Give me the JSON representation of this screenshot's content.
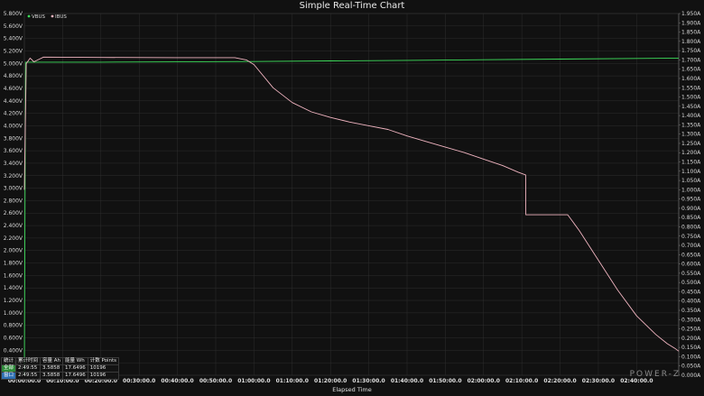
{
  "chart_data": {
    "type": "line",
    "title": "Simple Real-Time Chart",
    "xlabel": "Elapsed Time",
    "x_unit": "minutes",
    "xlim": [
      0,
      171
    ],
    "x_ticks": [
      "00:00:00.0",
      "00:10:00.0",
      "00:20:00.0",
      "00:30:00.0",
      "00:40:00.0",
      "00:50:00.0",
      "01:00:00.0",
      "01:10:00.0",
      "01:20:00.0",
      "01:30:00.0",
      "01:40:00.0",
      "01:50:00.0",
      "02:00:00.0",
      "02:10:00.0",
      "02:20:00.0",
      "02:30:00.0",
      "02:40:00.0"
    ],
    "y_left": {
      "ylim": [
        0,
        5.8
      ],
      "ticks": [
        "0.200V",
        "0.400V",
        "0.600V",
        "0.800V",
        "1.000V",
        "1.200V",
        "1.400V",
        "1.600V",
        "1.800V",
        "2.000V",
        "2.200V",
        "2.400V",
        "2.600V",
        "2.800V",
        "3.000V",
        "3.200V",
        "3.400V",
        "3.600V",
        "3.800V",
        "4.000V",
        "4.200V",
        "4.400V",
        "4.600V",
        "4.800V",
        "5.000V",
        "5.200V",
        "5.400V",
        "5.600V",
        "5.800V"
      ]
    },
    "y_right": {
      "ylim": [
        0,
        1.95
      ],
      "ticks": [
        "0.000A",
        "0.050A",
        "0.100A",
        "0.150A",
        "0.200A",
        "0.250A",
        "0.300A",
        "0.350A",
        "0.400A",
        "0.450A",
        "0.500A",
        "0.550A",
        "0.600A",
        "0.650A",
        "0.700A",
        "0.750A",
        "0.800A",
        "0.850A",
        "0.900A",
        "0.950A",
        "1.000A",
        "1.050A",
        "1.100A",
        "1.150A",
        "1.200A",
        "1.250A",
        "1.300A",
        "1.350A",
        "1.400A",
        "1.450A",
        "1.500A",
        "1.550A",
        "1.600A",
        "1.650A",
        "1.700A",
        "1.750A",
        "1.800A",
        "1.850A",
        "1.900A",
        "1.950A"
      ]
    },
    "grid": true,
    "legend_position": "top-left",
    "series": [
      {
        "name": "VBUS",
        "axis": "left",
        "color": "#3ddc5a",
        "x": [
          0,
          0.3,
          1,
          20,
          40,
          60,
          80,
          100,
          120,
          140,
          160,
          171
        ],
        "y": [
          0.0,
          5.02,
          5.02,
          5.02,
          5.025,
          5.03,
          5.04,
          5.05,
          5.06,
          5.07,
          5.08,
          5.085
        ]
      },
      {
        "name": "IBUS",
        "axis": "right",
        "color": "#f0b4c0",
        "x": [
          0,
          0.5,
          1.5,
          2.5,
          4,
          5,
          20,
          40,
          55,
          58,
          60,
          65,
          70,
          75,
          80,
          85,
          90,
          95,
          100,
          105,
          110,
          115,
          120,
          125,
          129,
          131,
          131.05,
          142,
          145,
          150,
          155,
          160,
          165,
          168,
          170,
          171
        ],
        "y": [
          1.0,
          1.68,
          1.71,
          1.69,
          1.705,
          1.715,
          1.713,
          1.712,
          1.712,
          1.7,
          1.675,
          1.55,
          1.47,
          1.42,
          1.39,
          1.365,
          1.345,
          1.325,
          1.29,
          1.26,
          1.23,
          1.2,
          1.165,
          1.13,
          1.095,
          1.08,
          0.865,
          0.865,
          0.78,
          0.62,
          0.46,
          0.32,
          0.22,
          0.17,
          0.145,
          0.13
        ]
      }
    ]
  },
  "stats_table": {
    "rows": [
      [
        "统计",
        "累计时间",
        "容量 Ah",
        "能量 Wh",
        "计数 Points"
      ],
      [
        "全部",
        "2:49:55",
        "3.5858",
        "17.6496",
        "10196"
      ],
      [
        "窗口",
        "2:49:55",
        "3.5858",
        "17.6496",
        "10196"
      ]
    ]
  },
  "logo": "POWER-Z"
}
